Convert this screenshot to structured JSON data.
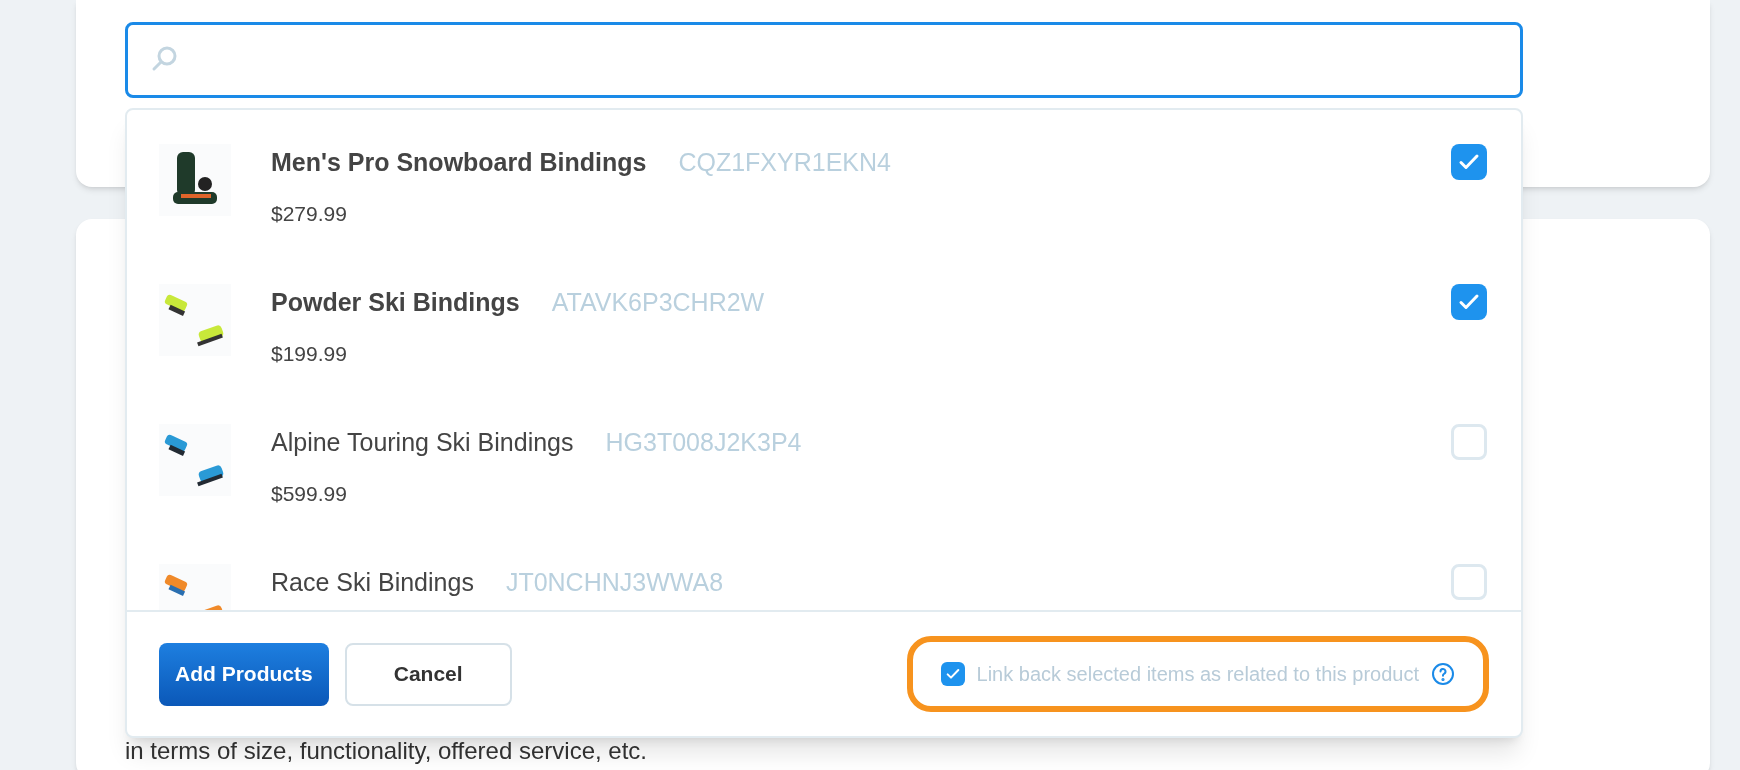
{
  "products": [
    {
      "name": "Men's Pro Snowboard Bindings",
      "sku": "CQZ1FXYR1EKN4",
      "price": "$279.99",
      "bold": true,
      "checked": true
    },
    {
      "name": "Powder Ski Bindings",
      "sku": "ATAVK6P3CHR2W",
      "price": "$199.99",
      "bold": true,
      "checked": true
    },
    {
      "name": "Alpine Touring Ski Bindings",
      "sku": "HG3T008J2K3P4",
      "price": "$599.99",
      "bold": false,
      "checked": false
    },
    {
      "name": "Race Ski Bindings",
      "sku": "JT0NCHNJ3WWA8",
      "bold": false,
      "checked": false
    }
  ],
  "buttons": {
    "primary": "Add Products",
    "secondary": "Cancel"
  },
  "link_back": {
    "label": "Link back selected items as related to this product",
    "checked": true,
    "highlighted": true
  },
  "background_text": "in terms of size, functionality, offered service, etc."
}
